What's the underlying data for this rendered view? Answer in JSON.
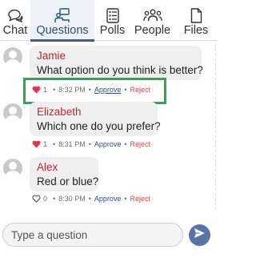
{
  "tabs": [
    {
      "label": "Chat",
      "icon": "chat-bubbles-icon"
    },
    {
      "label": "Questions",
      "icon": "question-slides-icon",
      "active": true
    },
    {
      "label": "Polls",
      "icon": "poll-list-icon"
    },
    {
      "label": "People",
      "icon": "people-group-icon"
    },
    {
      "label": "Files",
      "icon": "file-icon"
    }
  ],
  "questions": [
    {
      "author": "Jamie",
      "text": "What option do you think is better?",
      "likes": "1",
      "liked": true,
      "time": "8:32 PM",
      "approve": "Approve",
      "reject": "Reject"
    },
    {
      "author": "Elizabeth",
      "text": "Which one do you prefer?",
      "likes": "1",
      "liked": true,
      "time": "8:31 PM",
      "approve": "Approve",
      "reject": "Reject"
    },
    {
      "author": "Alex",
      "text": "Red or blue?",
      "likes": "0",
      "liked": false,
      "time": "8:30 PM",
      "approve": "Approve",
      "reject": "Reject"
    }
  ],
  "separator": "•",
  "input": {
    "placeholder": "Type a question",
    "value": ""
  },
  "colors": {
    "accent": "#3a5d8f",
    "author": "#c4262e",
    "heart": "#e0364a",
    "highlight": "#27ad47",
    "send": "#5a74a8",
    "reject": "#d04848"
  }
}
